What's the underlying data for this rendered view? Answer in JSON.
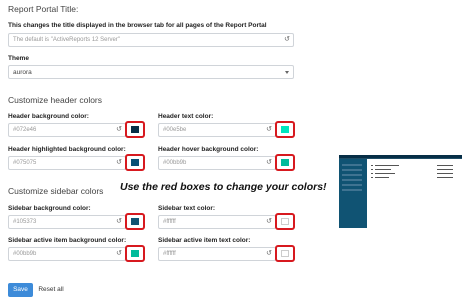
{
  "portal_title": {
    "heading": "Report Portal Title:",
    "description": "This changes the title displayed in the browser tab for all pages of the Report Portal",
    "placeholder": "The default is \"ActiveReports 12 Server\""
  },
  "theme": {
    "label": "Theme",
    "selected": "aurora"
  },
  "header_colors": {
    "heading": "Customize header colors",
    "background": {
      "label": "Header background color:",
      "value": "#072e46",
      "swatch": "#072e46"
    },
    "text": {
      "label": "Header text color:",
      "value": "#00e5be",
      "swatch": "#00e5be"
    },
    "highlighted_background": {
      "label": "Header highlighted background color:",
      "value": "#075075",
      "swatch": "#075075"
    },
    "hover_background": {
      "label": "Header hover background color:",
      "value": "#00bb9b",
      "swatch": "#00bb9b"
    }
  },
  "sidebar_colors": {
    "heading": "Customize sidebar colors",
    "background": {
      "label": "Sidebar background color:",
      "value": "#105373",
      "swatch": "#105373"
    },
    "text": {
      "label": "Sidebar text color:",
      "value": "#ffffff",
      "swatch": "#ffffff"
    },
    "active_item_background": {
      "label": "Sidebar active item background color:",
      "value": "#00bb9b",
      "swatch": "#00bb9b"
    },
    "active_item_text": {
      "label": "Sidebar active item text color:",
      "value": "#ffffff",
      "swatch": "#ffffff"
    }
  },
  "callout": "Use the red boxes to change your colors!",
  "buttons": {
    "save": "Save",
    "reset_all": "Reset all"
  },
  "icons": {
    "reset": "undo-icon",
    "dropdown": "caret-down-icon"
  },
  "colors": {
    "accent": "#3d8bd9",
    "highlight_box": "#d7191f"
  }
}
